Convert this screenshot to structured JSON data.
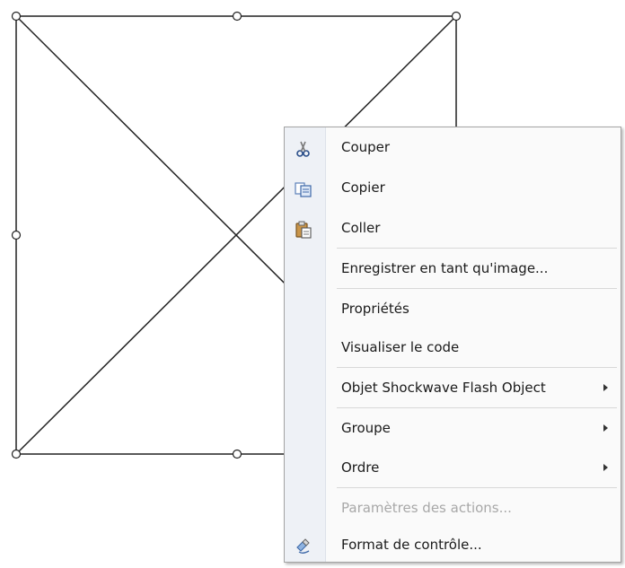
{
  "context_menu": {
    "items": [
      {
        "label": "Couper",
        "icon": "scissors-icon",
        "enabled": true,
        "submenu": false
      },
      {
        "label": "Copier",
        "icon": "copy-icon",
        "enabled": true,
        "submenu": false
      },
      {
        "label": "Coller",
        "icon": "paste-icon",
        "enabled": true,
        "submenu": false
      },
      {
        "label": "Enregistrer en tant qu'image...",
        "enabled": true,
        "submenu": false
      },
      {
        "label": "Propriétés",
        "enabled": true,
        "submenu": false
      },
      {
        "label": "Visualiser le code",
        "enabled": true,
        "submenu": false
      },
      {
        "label": "Objet Shockwave Flash Object",
        "enabled": true,
        "submenu": true
      },
      {
        "label": "Groupe",
        "enabled": true,
        "submenu": true
      },
      {
        "label": "Ordre",
        "enabled": true,
        "submenu": true
      },
      {
        "label": "Paramètres des actions...",
        "enabled": false,
        "submenu": false
      },
      {
        "label": "Format de contrôle...",
        "icon": "format-control-icon",
        "enabled": true,
        "submenu": false
      }
    ]
  },
  "colors": {
    "gutter": "#eef1f6",
    "menu_background": "#fafafa",
    "menu_border": "#a4a4a4",
    "disabled_text": "#a8a8a8"
  }
}
